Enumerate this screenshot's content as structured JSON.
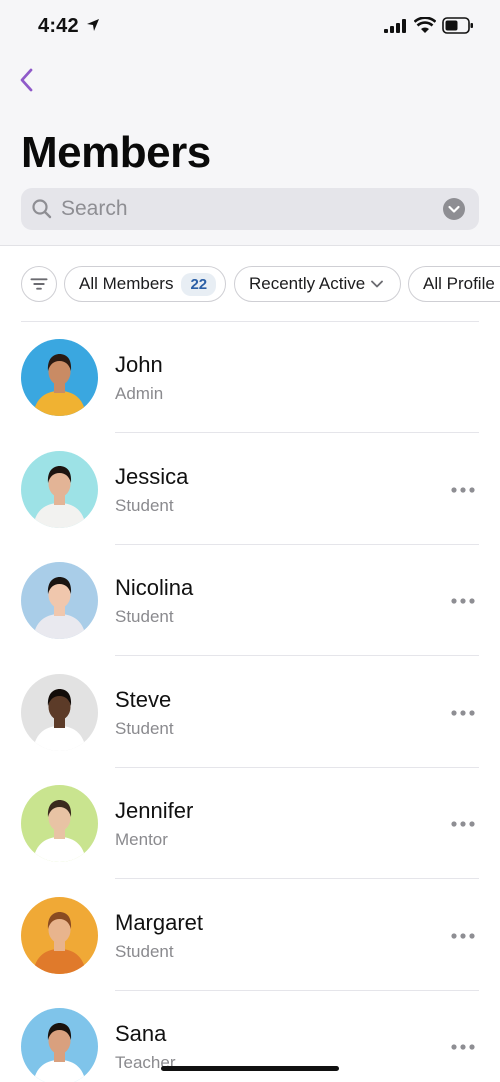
{
  "status_bar": {
    "time": "4:42"
  },
  "header": {
    "title": "Members"
  },
  "search": {
    "placeholder": "Search"
  },
  "filters": {
    "all_members_label": "All Members",
    "all_members_count": "22",
    "recently_active_label": "Recently Active",
    "all_profiles_label": "All Profile"
  },
  "members": [
    {
      "name": "John",
      "role": "Admin",
      "avatar_bg": "#3aa7e0",
      "shirt": "#f0b232",
      "hair": "#2a1a12",
      "skin": "#c98b64",
      "more": false
    },
    {
      "name": "Jessica",
      "role": "Student",
      "avatar_bg": "#9de2e6",
      "shirt": "#f2f2f0",
      "hair": "#1d1410",
      "skin": "#e3b496",
      "more": true
    },
    {
      "name": "Nicolina",
      "role": "Student",
      "avatar_bg": "#a9cde8",
      "shirt": "#e9e9ef",
      "hair": "#1a1512",
      "skin": "#f0c7ad",
      "more": true
    },
    {
      "name": "Steve",
      "role": "Student",
      "avatar_bg": "#e2e2e2",
      "shirt": "#ffffff",
      "hair": "#120c09",
      "skin": "#5c3b28",
      "more": true
    },
    {
      "name": "Jennifer",
      "role": "Mentor",
      "avatar_bg": "#c9e48f",
      "shirt": "#ffffff",
      "hair": "#3a2a1e",
      "skin": "#e8c3a4",
      "more": true
    },
    {
      "name": "Margaret",
      "role": "Student",
      "avatar_bg": "#f0a936",
      "shirt": "#e07a2b",
      "hair": "#8a4b22",
      "skin": "#e8b48d",
      "more": true
    },
    {
      "name": "Sana",
      "role": "Teacher",
      "avatar_bg": "#7fc4ea",
      "shirt": "#ffffff",
      "hair": "#1a120d",
      "skin": "#d9a07e",
      "more": true
    }
  ],
  "colors": {
    "accent": "#8f5ac9",
    "badge_text": "#2b5fa6",
    "secondary_text": "#8a8a8e"
  }
}
